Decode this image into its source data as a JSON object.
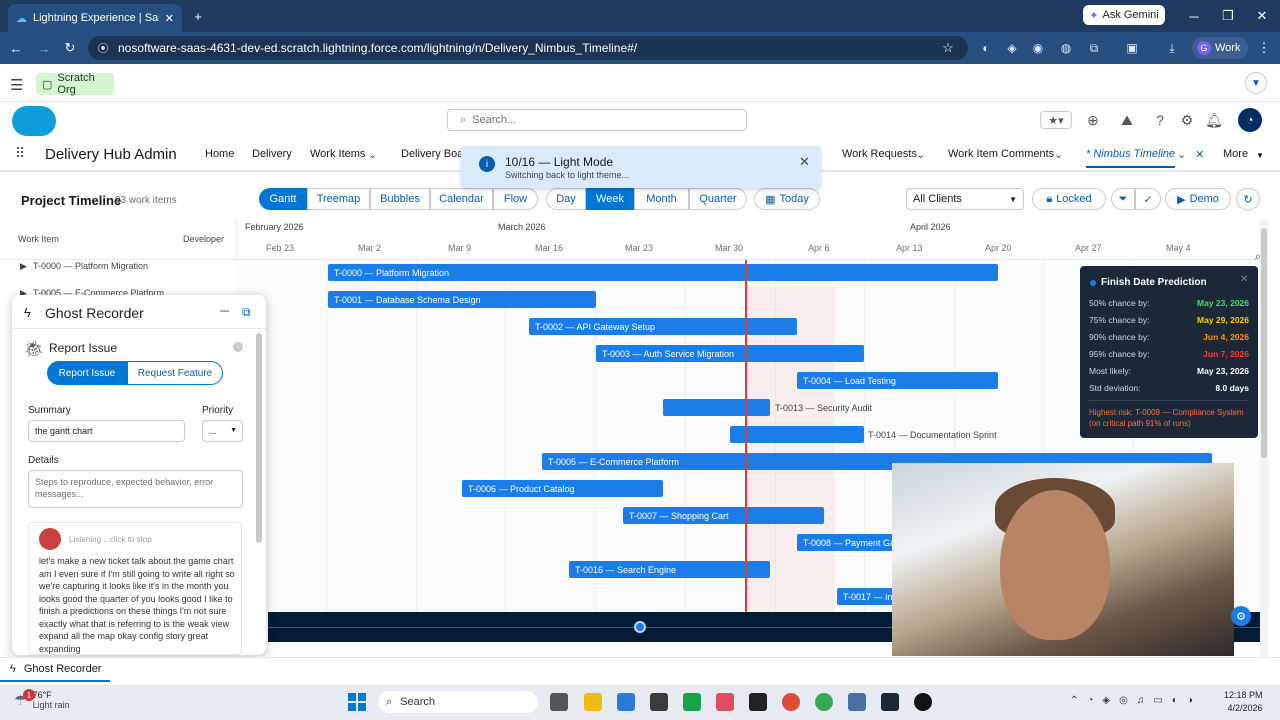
{
  "browser": {
    "tab_title": "Lightning Experience | Sales",
    "url": "nosoftware-saas-4631-dev-ed.scratch.lightning.force.com/lightning/n/Delivery_Nimbus_Timeline#/",
    "gemini_label": "Ask Gemini",
    "profile_label": "Work",
    "profile_initial": "G"
  },
  "sf": {
    "org_badge": "Scratch Org",
    "search_placeholder": "Search...",
    "app_name": "Delivery Hub Admin",
    "nav": [
      "Home",
      "Delivery",
      "Work Items",
      "Delivery Boar",
      "Work Requests",
      "Work Item Comments",
      "* Nimbus Timeline",
      "More"
    ]
  },
  "toast": {
    "title": "10/16 — Light Mode",
    "subtitle": "Switching back to light theme..."
  },
  "toolbar": {
    "title": "Project Timeline",
    "count": "23 work items",
    "views": [
      "Gantt",
      "Treemap",
      "Bubbles",
      "Calendar",
      "Flow"
    ],
    "active_view": "Gantt",
    "scales": [
      "Day",
      "Week",
      "Month",
      "Quarter"
    ],
    "active_scale": "Week",
    "today_label": "Today",
    "clients_select": "All Clients",
    "locked_label": "Locked",
    "demo_label": "Demo"
  },
  "timeline": {
    "left_header_work": "Work Item",
    "left_header_dev": "Developer",
    "months": [
      "February 2026",
      "March 2026",
      "April 2026"
    ],
    "weeks": [
      "Feb 23",
      "Mar 2",
      "Mar 9",
      "Mar 16",
      "Mar 23",
      "Mar 30",
      "Apr 6",
      "Apr 13",
      "Apr 20",
      "Apr 27",
      "May 4"
    ],
    "row_labels": [
      "T-0000 — Platform Migration",
      "T-0005 — E-Commerce Platform"
    ],
    "bars": [
      {
        "label": "T-0000 — Platform Migration",
        "inside": true
      },
      {
        "label": "T-0001 — Database Schema Design",
        "inside": true
      },
      {
        "label": "T-0002 — API Gateway Setup",
        "inside": true
      },
      {
        "label": "T-0003 — Auth Service Migration",
        "inside": true
      },
      {
        "label": "T-0004 — Load Testing",
        "inside": true
      },
      {
        "label": "T-0013 — Security Audit",
        "inside": false
      },
      {
        "label": "T-0014 — Documentation Sprint",
        "inside": false
      },
      {
        "label": "T-0005 — E-Commerce Platform",
        "inside": true
      },
      {
        "label": "T-0006 — Product Catalog",
        "inside": true
      },
      {
        "label": "T-0007 — Shopping Cart",
        "inside": true
      },
      {
        "label": "T-0008 — Payment Ga",
        "inside": true
      },
      {
        "label": "T-0016 — Search Engine",
        "inside": true
      },
      {
        "label": "T-0017 — In",
        "inside": true
      }
    ]
  },
  "prediction": {
    "title": "Finish Date Prediction",
    "rows": [
      {
        "label": "50% chance by:",
        "value": "May 23, 2026",
        "color": "#4cd964"
      },
      {
        "label": "75% chance by:",
        "value": "May 29, 2026",
        "color": "#ffcc00"
      },
      {
        "label": "90% chance by:",
        "value": "Jun 4, 2026",
        "color": "#ff9500"
      },
      {
        "label": "95% chance by:",
        "value": "Jun 7, 2026",
        "color": "#ff3b30"
      },
      {
        "label": "Most likely:",
        "value": "May 23, 2026",
        "color": "#ffffff"
      },
      {
        "label": "Std deviation:",
        "value": "8.0 days",
        "color": "#ffffff"
      }
    ],
    "risk": "Highest risk: T-0009 — Compliance System (on critical path 91% of runs)"
  },
  "ghost": {
    "title": "Ghost Recorder",
    "section": "Report Issue",
    "tab_report": "Report Issue",
    "tab_feature": "Request Feature",
    "summary_label": "Summary",
    "summary_value": "the gantt chart",
    "priority_label": "Priority",
    "priority_value": "...",
    "details_label": "Details",
    "details_placeholder": "Steps to reproduce, expected behavior, error messages...",
    "listening": "Listening... click to stop",
    "transcript": "let's make a new ticket talk about the game chart am I even sure if I'm still going to write all right so we're capturing it looks like it's in the month you looks good the quarter of you looks good I like to finish a predictions on these things I'm not sure exactly what that is referring to is the weak view expand all the map okay config story great expanding"
  },
  "footer": {
    "utility_tab": "Ghost Recorder"
  },
  "taskbar": {
    "temp": "76°F",
    "weather": "Light rain",
    "search": "Search",
    "time": "12:18 PM",
    "date": "4/2/2026",
    "badge": "1"
  }
}
